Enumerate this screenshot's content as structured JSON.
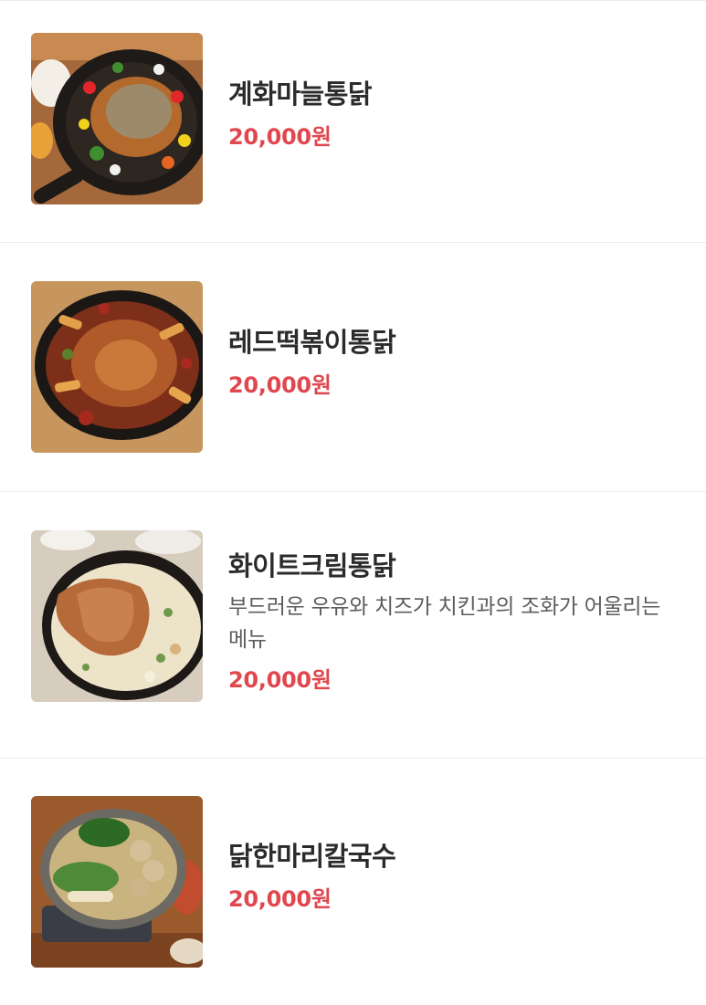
{
  "menu": {
    "items": [
      {
        "name": "계화마늘통닭",
        "description": "",
        "price": "20,000원",
        "image_icon": "garlic-chicken-skillet-photo"
      },
      {
        "name": "레드떡볶이통닭",
        "description": "",
        "price": "20,000원",
        "image_icon": "red-tteokbokki-chicken-skillet-photo"
      },
      {
        "name": "화이트크림통닭",
        "description": "부드러운 우유와 치즈가 치킨과의 조화가 어울리는 메뉴",
        "price": "20,000원",
        "image_icon": "white-cream-chicken-skillet-photo"
      },
      {
        "name": "닭한마리칼국수",
        "description": "",
        "price": "20,000원",
        "image_icon": "chicken-kalguksu-pot-photo"
      }
    ]
  },
  "colors": {
    "price": "#e0474f",
    "name": "#2b2b2b",
    "description": "#5c5c5c",
    "divider": "#ececec"
  }
}
